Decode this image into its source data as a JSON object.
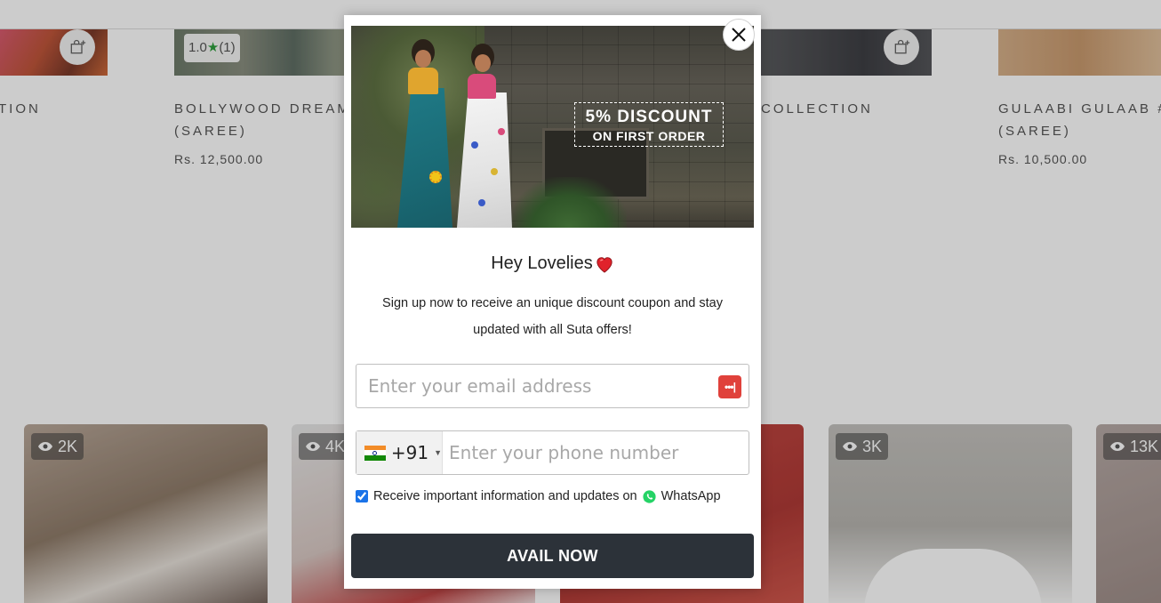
{
  "background": {
    "products": [
      {
        "title_lines": [
          "TION"
        ],
        "price": ""
      },
      {
        "title_lines": [
          "BOLLYWOOD DREAM",
          "(SAREE)"
        ],
        "price": "Rs. 12,500.00",
        "rating": "1.0",
        "rating_count": "(1)"
      },
      {
        "title_lines": [
          "COLLECTION"
        ],
        "price": ""
      },
      {
        "title_lines": [
          "GULAABI GULAAB #",
          "(SAREE)"
        ],
        "price": "Rs. 10,500.00"
      }
    ],
    "video_views": [
      "2K",
      "4K",
      "",
      "3K",
      "13K"
    ]
  },
  "modal": {
    "promo_big": "5% DISCOUNT",
    "promo_small": "ON FIRST ORDER",
    "heading": "Hey Lovelies",
    "subtext": "Sign up now to receive an unique discount coupon and stay updated with all Suta offers!",
    "email_placeholder": "Enter your email address",
    "country_code": "+91",
    "phone_placeholder": "Enter your phone number",
    "consent_text": "Receive important information and updates on",
    "consent_brand": "WhatsApp",
    "consent_checked": true,
    "button_label": "AVAIL NOW"
  },
  "colors": {
    "button_bg": "#2c3239",
    "whatsapp": "#25d366",
    "heart": "#e0222b"
  },
  "icons": [
    "close-icon",
    "heart-icon",
    "password-manager-icon",
    "india-flag-icon",
    "whatsapp-icon",
    "shopping-bag-icon",
    "eye-icon",
    "star-icon"
  ]
}
